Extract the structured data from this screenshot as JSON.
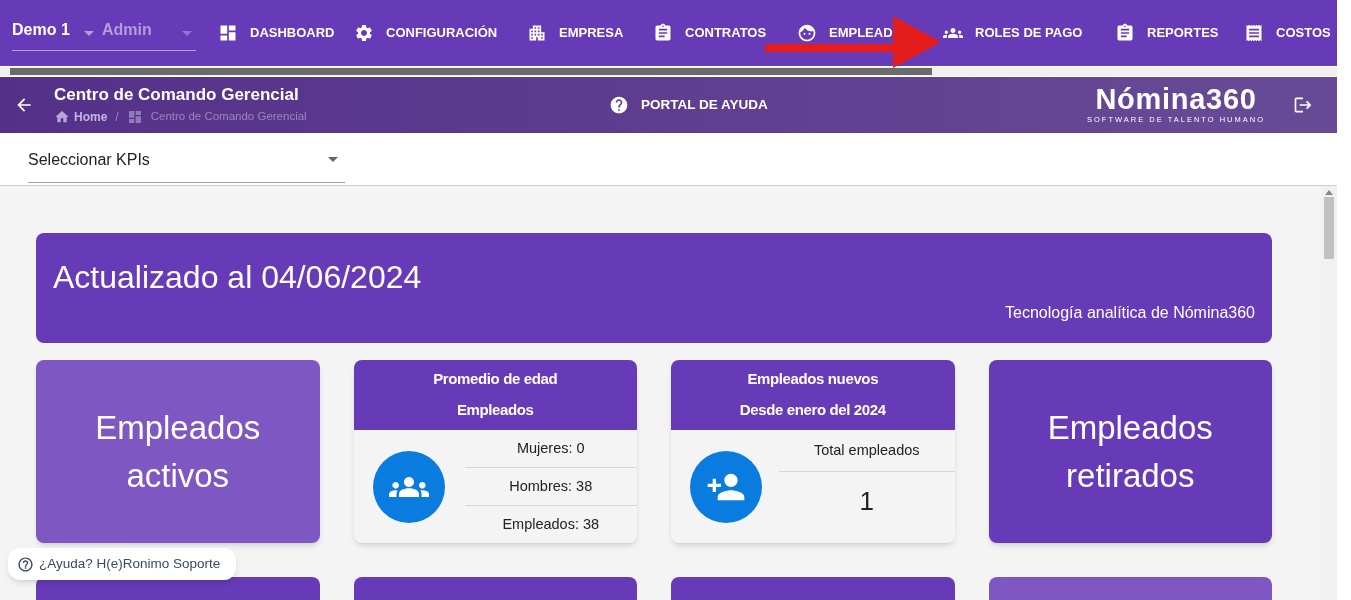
{
  "topbar": {
    "company": "Demo 1",
    "role": "Admin",
    "nav": [
      {
        "label": "DASHBOARD"
      },
      {
        "label": "CONFIGURACIÓN"
      },
      {
        "label": "EMPRESA"
      },
      {
        "label": "CONTRATOS"
      },
      {
        "label": "EMPLEAD"
      },
      {
        "label": "ROLES DE PAGO"
      },
      {
        "label": "REPORTES"
      },
      {
        "label": "COSTOS"
      }
    ]
  },
  "header": {
    "title": "Centro de Comando Gerencial",
    "breadcrumb": [
      "Home",
      "/",
      "Centro de Comando Gerencial"
    ],
    "help": "PORTAL DE AYUDA",
    "logo": "Nómina360",
    "tagline": "SOFTWARE DE TALENTO HUMANO"
  },
  "kpi_select": {
    "value": "Seleccionar KPIs"
  },
  "banner": {
    "title": "Actualizado al 04/06/2024",
    "subtitle": "Tecnología analítica de Nómina360"
  },
  "cards": [
    {
      "kind": "big",
      "lines": [
        "Empleados",
        "activos"
      ],
      "color": "#7e57c2"
    },
    {
      "kind": "stats",
      "title": [
        "Promedio de edad",
        "Empleados"
      ],
      "rows": [
        "Mujeres: 0",
        "Hombres: 38",
        "Empleados: 38"
      ]
    },
    {
      "kind": "total",
      "title": [
        "Empleados nuevos",
        "Desde enero del 2024"
      ],
      "label": "Total empleados",
      "value": "1"
    },
    {
      "kind": "big",
      "lines": [
        "Empleados",
        "retirados"
      ],
      "color": "#673ab7"
    }
  ],
  "more_cards": [
    {
      "color": "#673ab7"
    },
    {
      "color": "#673ab7"
    },
    {
      "color": "#673ab7"
    },
    {
      "color": "#7e57c2"
    }
  ],
  "help_chip": "¿Ayuda? H(e)Ronimo Soporte"
}
